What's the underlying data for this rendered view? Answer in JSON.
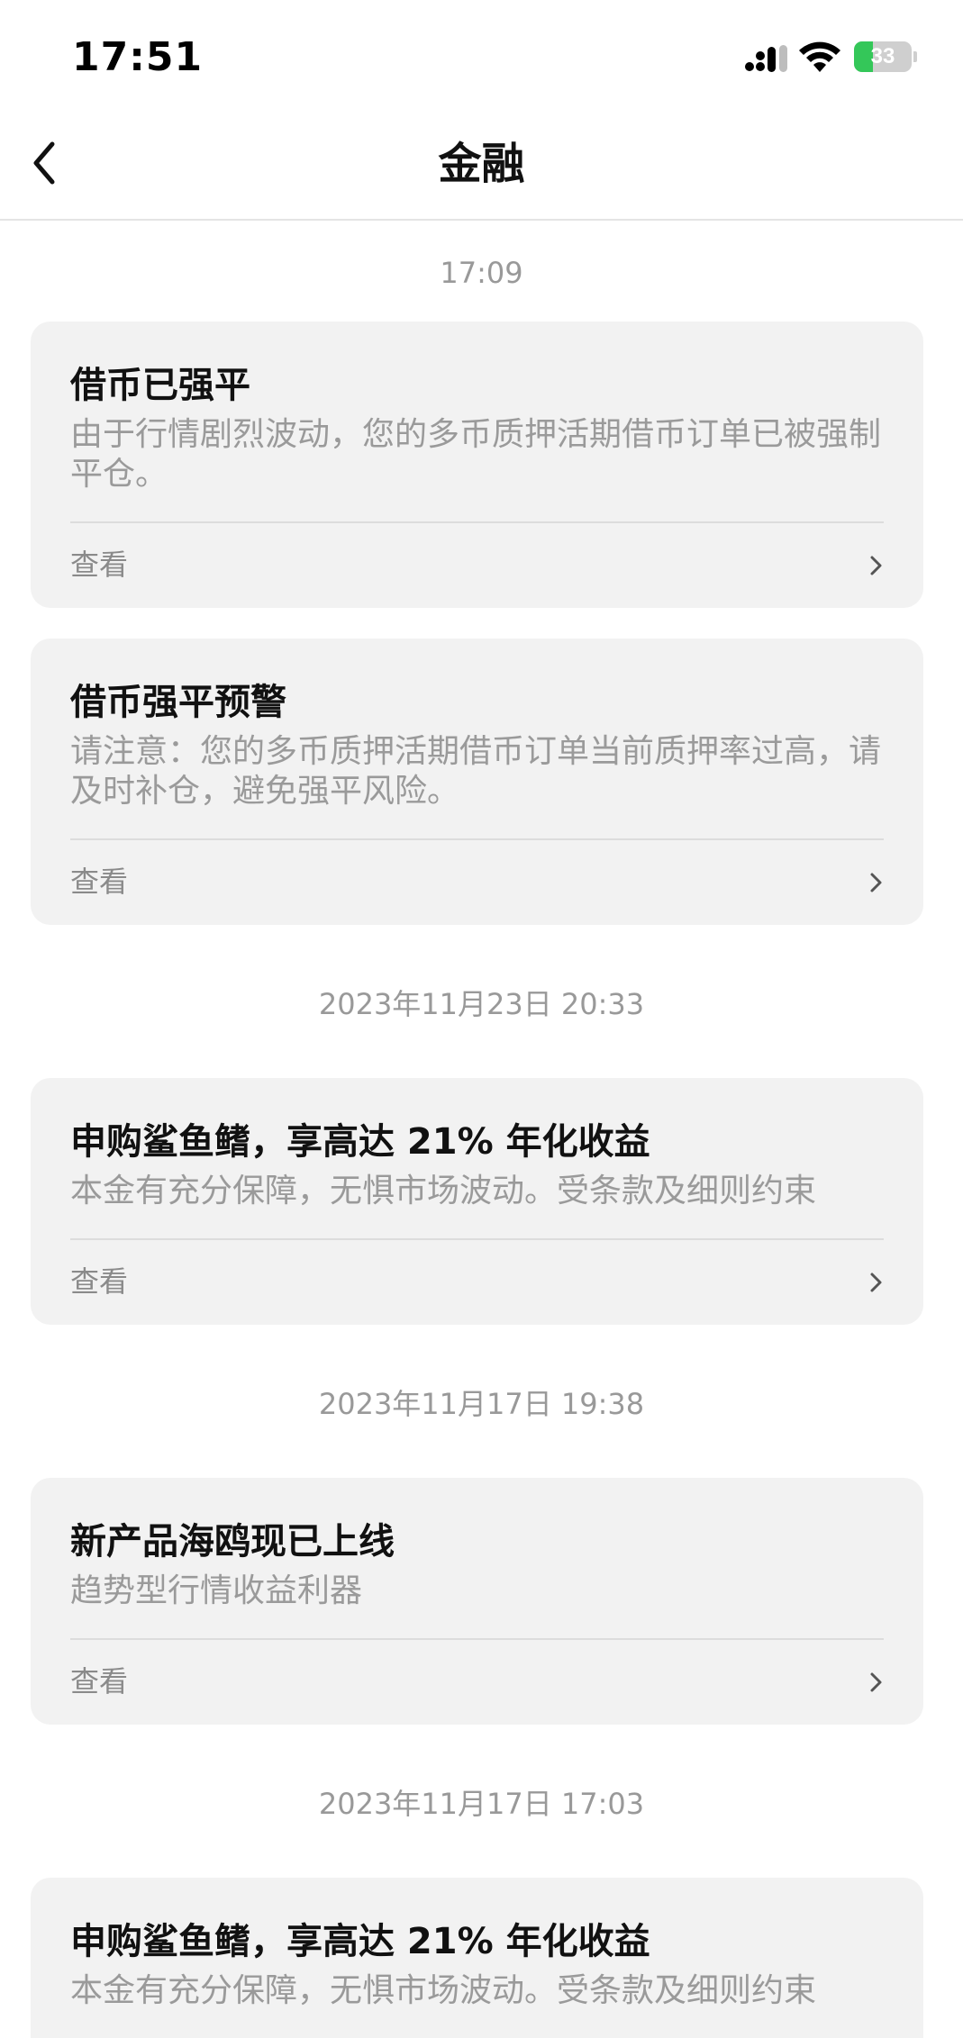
{
  "status_bar": {
    "time": "17:51",
    "battery_level": "33",
    "battery_fraction": 0.33,
    "battery_color": "#34c759"
  },
  "nav": {
    "back_icon": "chevron-left-icon",
    "title": "金融"
  },
  "feed": [
    {
      "timestamp": "17:09",
      "cards": [
        {
          "title": "借币已强平",
          "body": "由于行情剧烈波动，您的多币质押活期借币订单已被强制平仓。",
          "action_label": "查看"
        },
        {
          "title": "借币强平预警",
          "body": "请注意：您的多币质押活期借币订单当前质押率过高，请及时补仓，避免强平风险。",
          "action_label": "查看"
        }
      ]
    },
    {
      "timestamp": "2023年11月23日 20:33",
      "cards": [
        {
          "title": "申购鲨鱼鳍，享高达 21% 年化收益",
          "body": "本金有充分保障，无惧市场波动。受条款及细则约束",
          "action_label": "查看"
        }
      ]
    },
    {
      "timestamp": "2023年11月17日 19:38",
      "cards": [
        {
          "title": "新产品海鸥现已上线",
          "body": "趋势型行情收益利器",
          "action_label": "查看"
        }
      ]
    },
    {
      "timestamp": "2023年11月17日 17:03",
      "cards": [
        {
          "title": "申购鲨鱼鳍，享高达 21% 年化收益",
          "body": "本金有充分保障，无惧市场波动。受条款及细则约束",
          "action_label": "查看"
        }
      ]
    }
  ]
}
